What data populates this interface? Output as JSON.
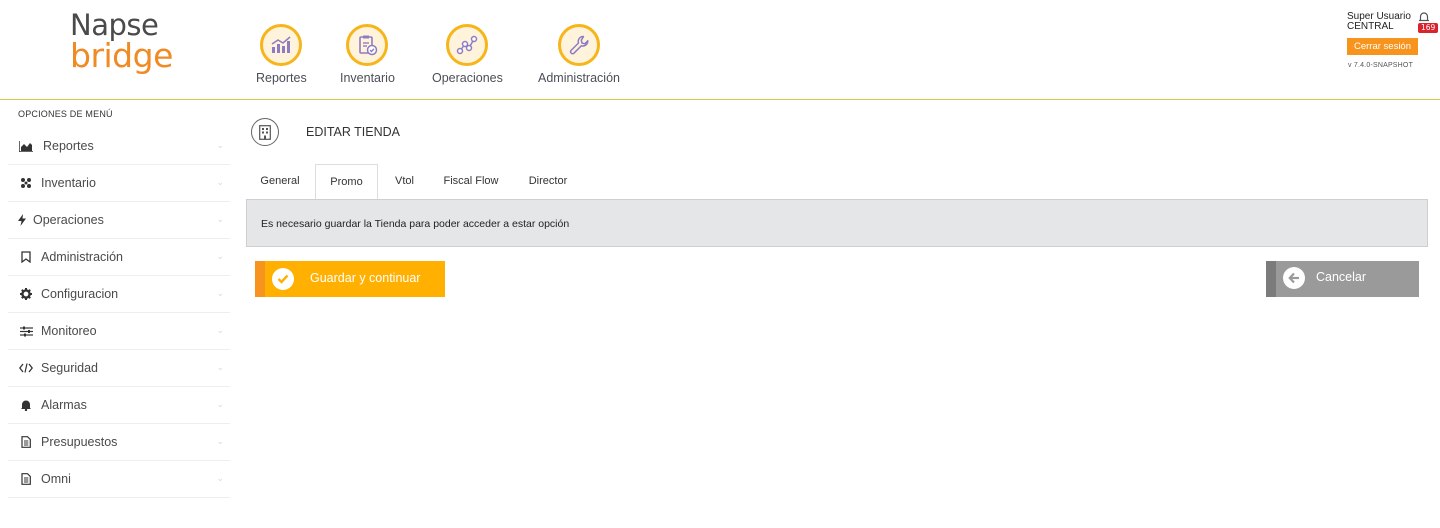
{
  "brand": {
    "line1": "Napse",
    "line2": "bridge"
  },
  "topnav": [
    {
      "label": "Reportes",
      "icon": "chart-icon"
    },
    {
      "label": "Inventario",
      "icon": "clipboard-check-icon"
    },
    {
      "label": "Operaciones",
      "icon": "nodes-icon"
    },
    {
      "label": "Administración",
      "icon": "wrench-icon"
    }
  ],
  "user": {
    "name": "Super Usuario",
    "store": "CENTRAL",
    "logout_label": "Cerrar sesión",
    "version": "v 7.4.0-SNAPSHOT",
    "notifications": "169"
  },
  "sidebar": {
    "title": "OPCIONES DE MENÚ",
    "items": [
      {
        "label": "Reportes",
        "icon": "area-chart-icon"
      },
      {
        "label": "Inventario",
        "icon": "boxes-icon"
      },
      {
        "label": "Operaciones",
        "icon": "bolt-icon"
      },
      {
        "label": "Administración",
        "icon": "bookmark-icon"
      },
      {
        "label": "Configuracion",
        "icon": "gear-icon"
      },
      {
        "label": "Monitoreo",
        "icon": "sliders-icon"
      },
      {
        "label": "Seguridad",
        "icon": "code-icon"
      },
      {
        "label": "Alarmas",
        "icon": "bell-icon"
      },
      {
        "label": "Presupuestos",
        "icon": "document-icon"
      },
      {
        "label": "Omni",
        "icon": "document-icon"
      }
    ]
  },
  "page": {
    "title": "EDITAR TIENDA",
    "tabs": [
      "General",
      "Promo",
      "Vtol",
      "Fiscal Flow",
      "Director"
    ],
    "active_tab": "Promo",
    "message": "Es necesario guardar la Tienda para poder acceder a estar opción",
    "save_label": "Guardar y continuar",
    "cancel_label": "Cancelar"
  },
  "colors": {
    "accent": "#f7941d",
    "save_button": "#ffb000",
    "cancel_button": "#9a9a9a",
    "badge": "#d9232d",
    "alert_bg": "#e5e6e7"
  }
}
